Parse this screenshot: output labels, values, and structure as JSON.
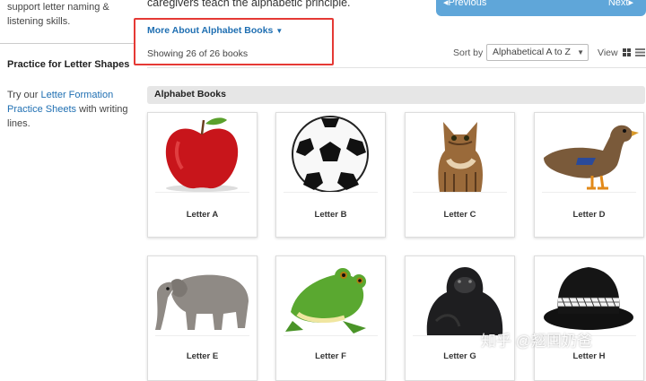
{
  "sidebar": {
    "fragment_line": "support letter naming &",
    "fragment_line2": "listening skills.",
    "heading": "Practice for Letter Shapes",
    "para_prefix": "Try our ",
    "link_text": "Letter Formation Practice Sheets",
    "para_suffix": " with writing lines."
  },
  "intro": {
    "text": "caregivers teach the alphabetic principle."
  },
  "pager": {
    "prev": "Previous",
    "next": "Next"
  },
  "info": {
    "more_about": "More About Alphabet Books",
    "showing": "Showing 26 of 26 books"
  },
  "controls": {
    "sort_label": "Sort by",
    "sort_value": "Alphabetical A to Z",
    "view_label": "View"
  },
  "section": {
    "title": "Alphabet Books"
  },
  "books": [
    {
      "label": "Letter A",
      "icon": "apple-image"
    },
    {
      "label": "Letter B",
      "icon": "soccer-ball-image"
    },
    {
      "label": "Letter C",
      "icon": "cat-image"
    },
    {
      "label": "Letter D",
      "icon": "duck-image"
    },
    {
      "label": "Letter E",
      "icon": "elephant-image"
    },
    {
      "label": "Letter F",
      "icon": "frog-image"
    },
    {
      "label": "Letter G",
      "icon": "gorilla-image"
    },
    {
      "label": "Letter H",
      "icon": "hat-image"
    }
  ],
  "watermark": "知乎 @翘囤奶爸",
  "colors": {
    "link": "#1f6fb2",
    "pager": "#5fa6d9",
    "highlight": "#e53935",
    "section_bar": "#e6e6e6"
  }
}
